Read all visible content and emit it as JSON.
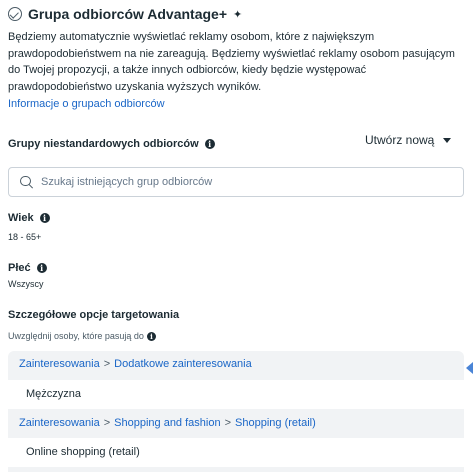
{
  "header": {
    "title": "Grupa odbiorców Advantage+",
    "description": "Będziemy automatycznie wyświetlać reklamy osobom, które z największym prawdopodobieństwem na nie zareagują. Będziemy wyświetlać reklamy osobom pasującym do Twojej propozycji, a także innych odbiorców, kiedy będzie występować prawdopodobieństwo uzyskania wyższych wyników.",
    "link": "Informacje o grupach odbiorców"
  },
  "custom_audiences": {
    "title": "Grupy niestandardowych odbiorców",
    "create_label": "Utwórz nową",
    "search_placeholder": "Szukaj istniejących grup odbiorców",
    "search_value": ""
  },
  "age": {
    "label": "Wiek",
    "value": "18 - 65+"
  },
  "gender": {
    "label": "Płeć",
    "value": "Wszyscy"
  },
  "detailed_targeting": {
    "title": "Szczegółowe opcje targetowania",
    "include_label": "Uwzględnij osoby, które pasują do",
    "groups": [
      {
        "crumbs": [
          "Zainteresowania",
          "Dodatkowe zainteresowania"
        ],
        "item": "Mężczyzna"
      },
      {
        "crumbs": [
          "Zainteresowania",
          "Shopping and fashion",
          "Shopping (retail)"
        ],
        "item": "Online shopping (retail)"
      }
    ],
    "separator": ">"
  },
  "icons": {
    "status": "check-circle-icon",
    "ai": "sparkle-icon",
    "info": "info-icon",
    "dropdown": "caret-down-icon",
    "search": "search-icon"
  },
  "colors": {
    "text": "#1c2b33",
    "link": "#1a66c7",
    "panel": "#f1f3f5",
    "border": "#cbd2d9"
  }
}
